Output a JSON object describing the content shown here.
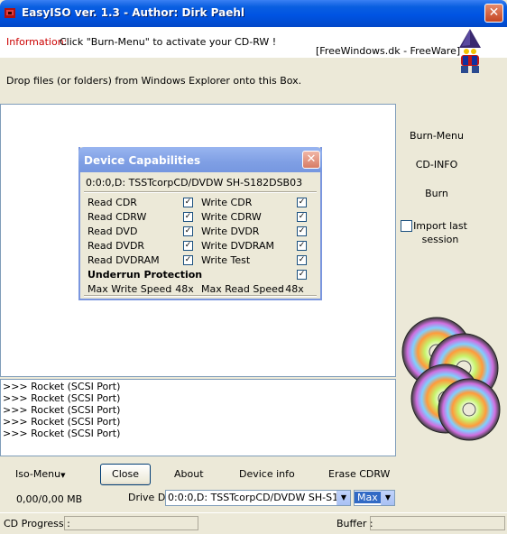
{
  "window": {
    "title": "EasyISO ver. 1.3 - Author: Dirk Paehl",
    "close_glyph": "✕"
  },
  "info": {
    "label": "Information:",
    "text": "Click \"Burn-Menu\" to activate your CD-RW !",
    "site": "[FreeWindows.dk - FreeWare]"
  },
  "drop_hint": "Drop files (or folders)  from Windows Explorer onto this Box.",
  "right_panel": {
    "burn_menu": "Burn-Menu",
    "cd_info": "CD-INFO",
    "burn": "Burn",
    "import_last_session": "Import last session"
  },
  "log": {
    "lines": [
      ">>> Rocket (SCSI Port)",
      ">>> Rocket (SCSI Port)",
      ">>> Rocket (SCSI Port)",
      ">>> Rocket (SCSI Port)",
      ">>> Rocket (SCSI Port)"
    ]
  },
  "bottom": {
    "iso_menu": "Iso-Menu",
    "close": "Close",
    "about": "About",
    "device_info": "Device info",
    "erase_cdrw": "Erase CDRW",
    "size": "0,00/0,00 MB",
    "drive_label": "Drive D:",
    "drive_value": "0:0:0,D: TSSTcorpCD/DVDW SH-S182DSB03",
    "speed_value": "Max"
  },
  "status": {
    "cd_progress": "CD Progress :",
    "buffer": "Buffer :"
  },
  "dialog": {
    "title": "Device Capabilities",
    "close_glyph": "✕",
    "device": "0:0:0,D: TSSTcorpCD/DVDW SH-S182DSB03",
    "left": [
      {
        "label": "Read CDR",
        "checked": true
      },
      {
        "label": "Read CDRW",
        "checked": true
      },
      {
        "label": "Read DVD",
        "checked": true
      },
      {
        "label": "Read DVDR",
        "checked": true
      },
      {
        "label": "Read DVDRAM",
        "checked": true
      }
    ],
    "right": [
      {
        "label": "Write CDR",
        "checked": true
      },
      {
        "label": "Write CDRW",
        "checked": true
      },
      {
        "label": "Write DVDR",
        "checked": true
      },
      {
        "label": "Write DVDRAM",
        "checked": true
      },
      {
        "label": "Write Test",
        "checked": true
      }
    ],
    "underrun_label": "Underrun Protection",
    "underrun_checked": true,
    "max_write_label": "Max Write Speed",
    "max_write_value": ":   48x",
    "max_read_label": "Max Read Speed",
    "max_read_value": ":   48x",
    "check_glyph": "✓"
  },
  "colors": {
    "info_label": "#cc0000",
    "titlebar": "#0054e3",
    "dialog_titlebar": "#7f9fe4"
  }
}
